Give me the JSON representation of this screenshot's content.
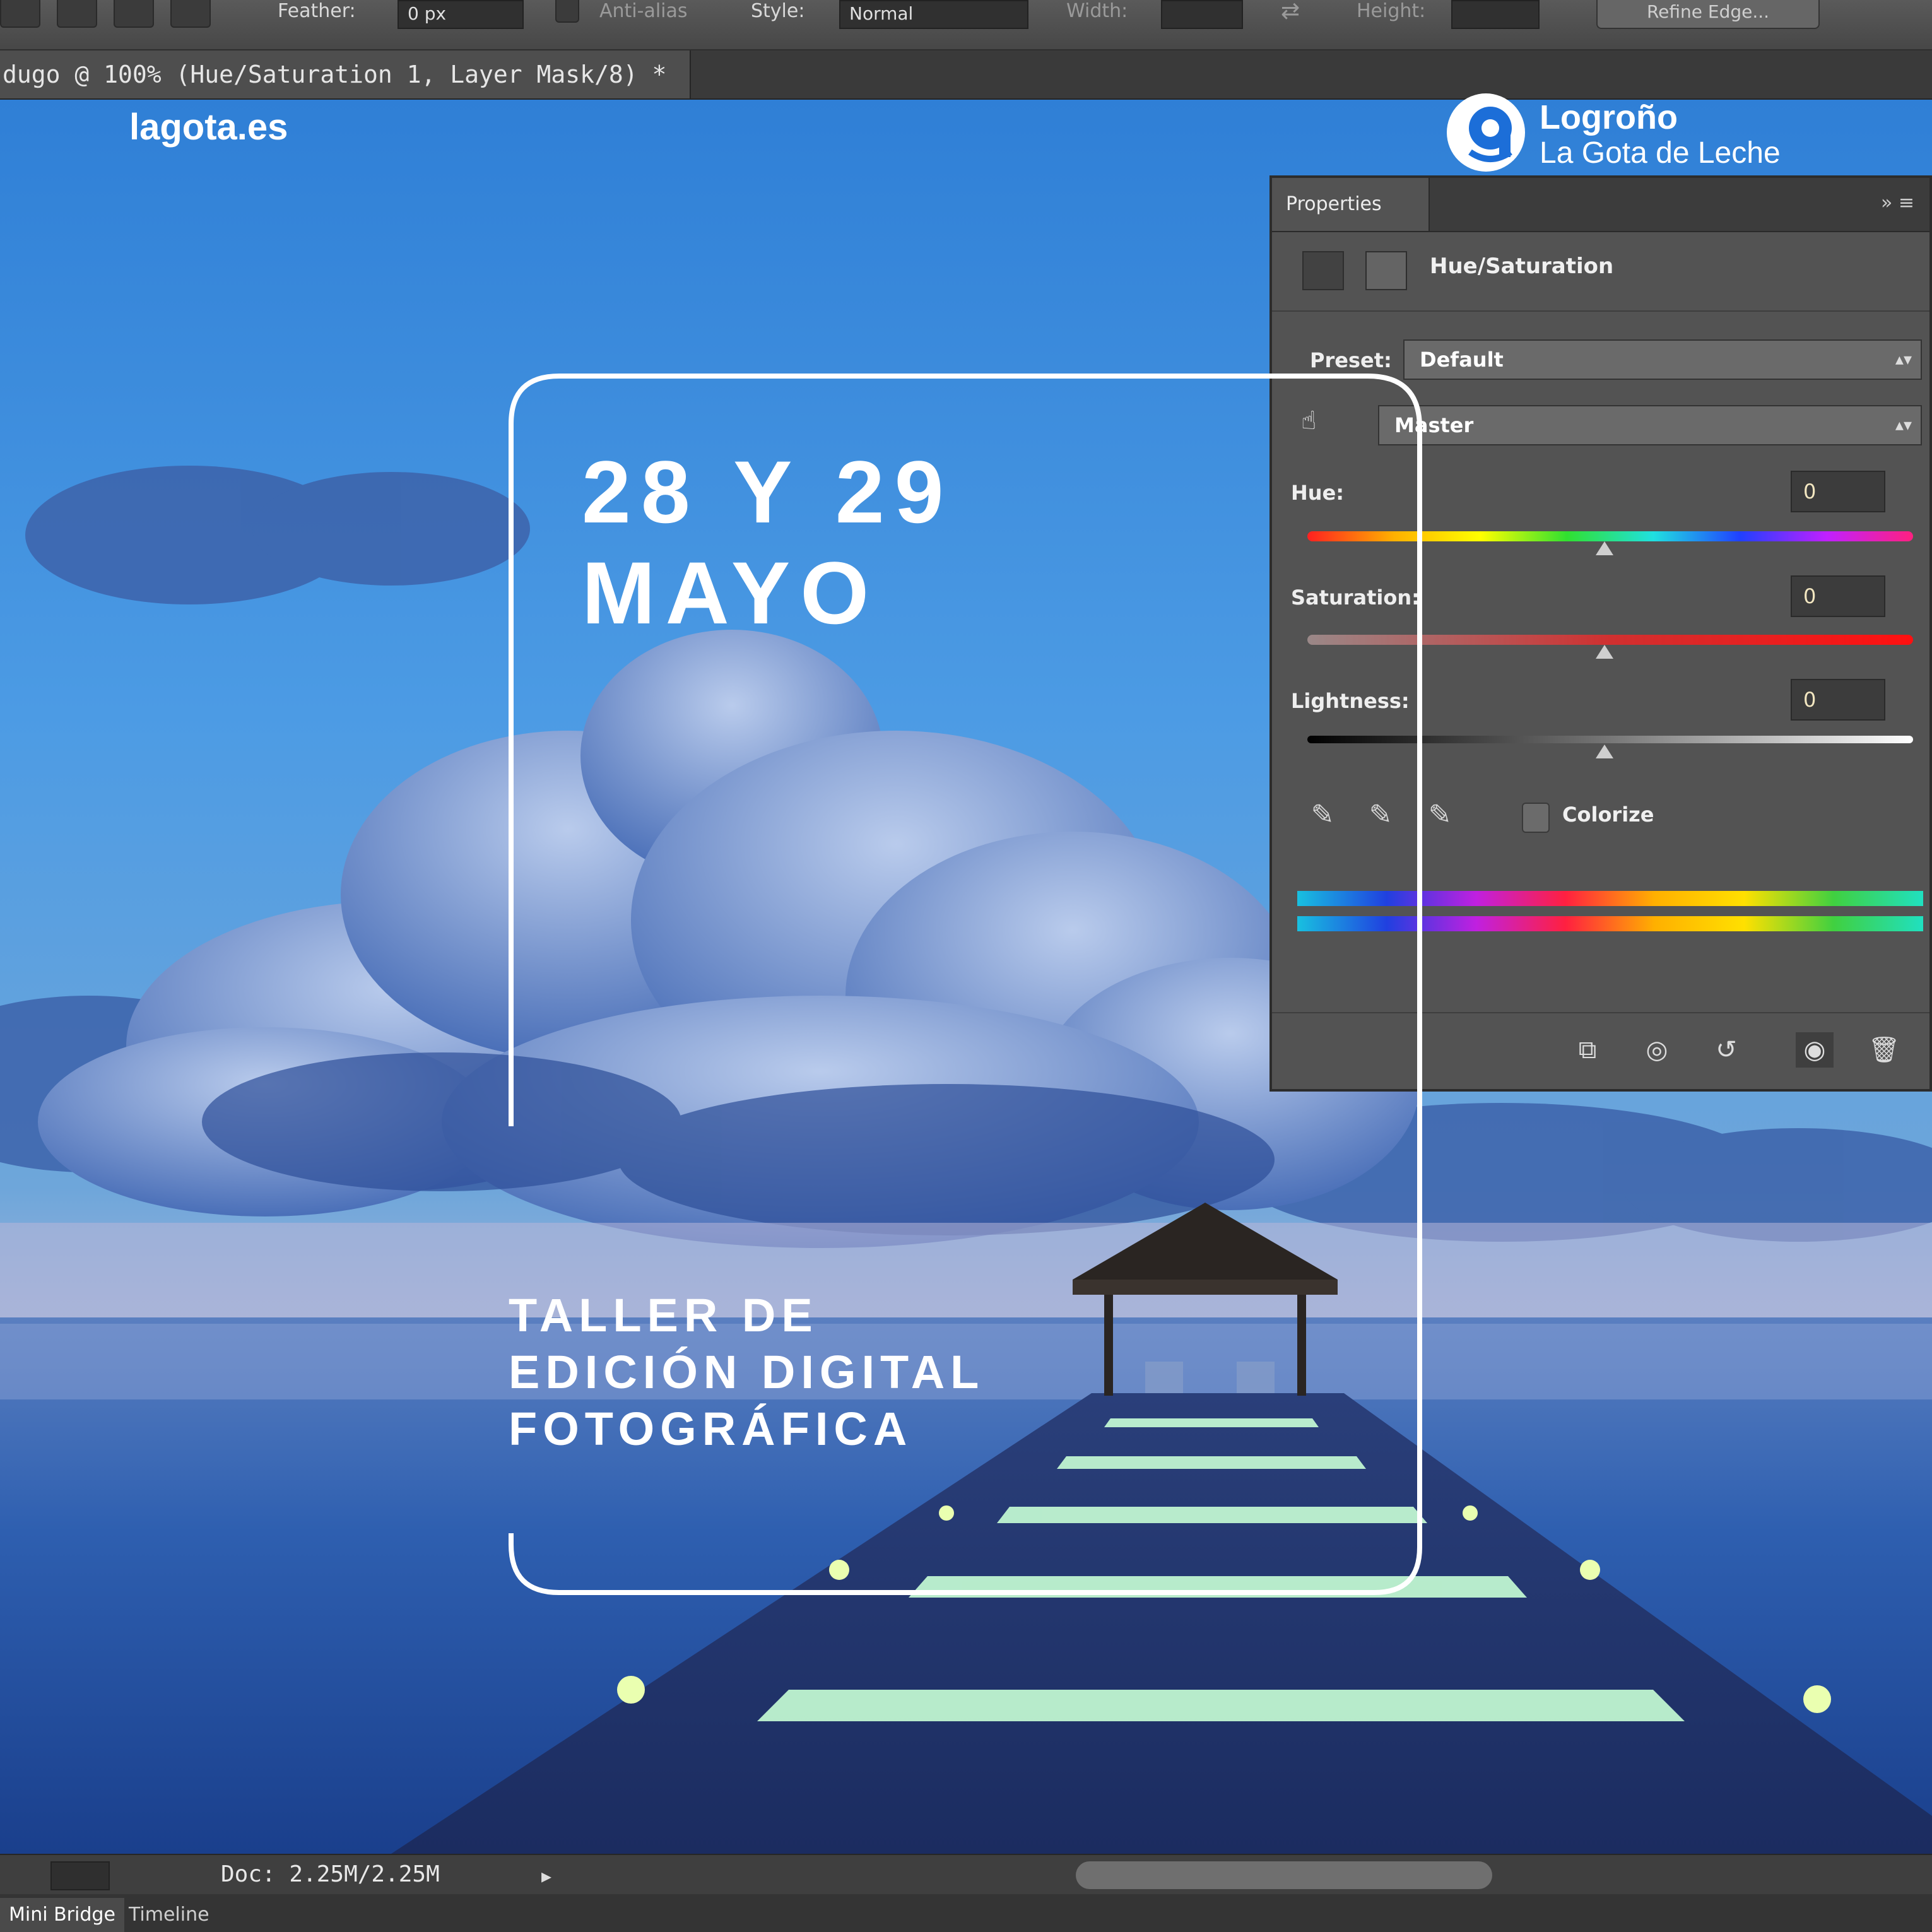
{
  "brand": {
    "site": "lagota.es",
    "logo_name": "Logroño",
    "logo_sub": "La Gota de Leche",
    "colors": {
      "accent": "#1c6ed8",
      "text": "#ffffff"
    }
  },
  "event": {
    "date": "28 Y 29\nMAYO",
    "title": "TALLER DE\nEDICIÓN DIGITAL\nFOTOGRÁFICA"
  },
  "photoshop": {
    "doc_tab": "dugo @ 100% (Hue/Saturation 1, Layer Mask/8) *",
    "options": {
      "feather_label": "Feather:",
      "feather_value": "0 px",
      "antialias_label": "Anti-alias",
      "style_label": "Style:",
      "style_value": "Normal",
      "width_label": "Width:",
      "height_label": "Height:",
      "refine_label": "Refine Edge..."
    },
    "status": {
      "doc_size": "Doc: 2.25M/2.25M"
    },
    "bottom_tabs": [
      "Mini Bridge",
      "Timeline"
    ],
    "properties": {
      "tab": "Properties",
      "title": "Hue/Saturation",
      "preset_label": "Preset:",
      "preset_value": "Default",
      "channel_value": "Master",
      "hue_label": "Hue:",
      "hue_value": "0",
      "saturation_label": "Saturation:",
      "saturation_value": "0",
      "lightness_label": "Lightness:",
      "lightness_value": "0",
      "colorize_label": "Colorize"
    },
    "icons": [
      "adjustment-icon",
      "mask-icon",
      "hand-adjust-icon",
      "eyedropper-icon",
      "eyedropper-plus-icon",
      "eyedropper-minus-icon",
      "clip-layer-icon",
      "view-previous-icon",
      "reset-icon",
      "visibility-icon",
      "trash-icon"
    ]
  }
}
